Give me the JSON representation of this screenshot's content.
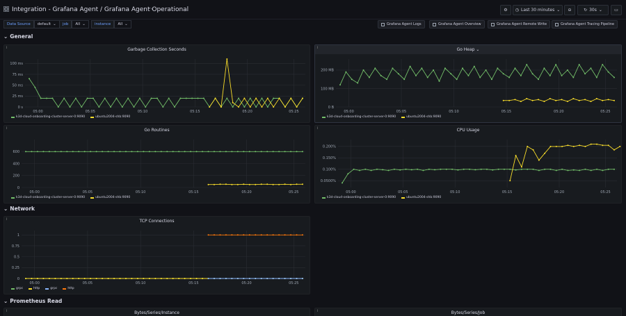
{
  "header": {
    "title_crumb": "Integration - Grafana Agent  / Grafana Agent Operational",
    "time_range": "Last 30 minutes",
    "refresh": "30s"
  },
  "variables": [
    {
      "label": "Data Source",
      "value": "default"
    },
    {
      "label": "job",
      "value": "All"
    },
    {
      "label": "instance",
      "value": "All"
    }
  ],
  "links": [
    "Grafana Agent Logs",
    "Grafana Agent Overview",
    "Grafana Agent Remote Write",
    "Grafana Agent Tracing Pipeline"
  ],
  "rows": {
    "general": "General",
    "network": "Network",
    "prometheus_read": "Prometheus Read"
  },
  "colors": {
    "green": "#73bf69",
    "yellow": "#fade2a",
    "blue": "#8ab8ff",
    "orange": "#ff780a"
  },
  "x_ticks": [
    "05:00",
    "05:05",
    "05:10",
    "05:15",
    "05:20",
    "05:25"
  ],
  "legend_default": [
    "k3d-cloud-onboarding-cluster-server-0:9090",
    "ubuntu2004-shb:9090"
  ],
  "legend_tcp": [
    "grpc",
    "http",
    "grpc",
    "http"
  ],
  "panels": {
    "gc": {
      "title": "Garbage Collection Seconds",
      "y_ticks": [
        "100 ms",
        "75 ms",
        "50 ms",
        "25 ms",
        "0 s"
      ]
    },
    "heap": {
      "title": "Go Heap",
      "y_ticks": [
        "200 MB",
        "100 MB",
        "0 B"
      ]
    },
    "routines": {
      "title": "Go Routines",
      "y_ticks": [
        "800",
        "600",
        "400",
        "200",
        "0"
      ]
    },
    "cpu": {
      "title": "CPU Usage",
      "y_ticks": [
        "0.200%",
        "0.150%",
        "0.100%",
        "0.0500%"
      ]
    },
    "tcp": {
      "title": "TCP Connections",
      "y_ticks": [
        "1",
        "0.75",
        "0.5",
        "0.25",
        "0"
      ]
    },
    "bytes_instance": {
      "title": "Bytes/Series/Instance"
    },
    "bytes_job": {
      "title": "Bytes/Series/Job"
    }
  },
  "chart_data": [
    {
      "type": "line",
      "title": "Garbage Collection Seconds",
      "ylim": [
        0,
        110
      ],
      "unit": "ms",
      "series": [
        {
          "name": "k3d-cloud-onboarding-cluster-server-0:9090",
          "values": [
            65,
            45,
            20,
            20,
            20,
            0,
            20,
            0,
            20,
            0,
            20,
            20,
            0,
            20,
            0,
            20,
            0,
            20,
            0,
            20,
            0,
            20,
            20,
            0,
            20,
            0,
            20,
            20,
            20,
            20,
            20,
            0,
            20,
            0,
            20,
            0,
            20,
            0,
            20,
            0,
            20,
            0,
            20,
            20,
            0,
            20,
            0,
            20
          ]
        },
        {
          "name": "ubuntu2004-shb:9090",
          "values": [
            null,
            null,
            null,
            null,
            null,
            null,
            null,
            null,
            null,
            null,
            null,
            null,
            null,
            null,
            null,
            null,
            null,
            null,
            null,
            null,
            null,
            null,
            null,
            null,
            null,
            null,
            null,
            null,
            null,
            null,
            null,
            0,
            20,
            0,
            110,
            10,
            0,
            20,
            0,
            20,
            0,
            20,
            0,
            20,
            0,
            20,
            0,
            20
          ]
        }
      ]
    },
    {
      "type": "line",
      "title": "Go Heap",
      "ylim": [
        0,
        260
      ],
      "unit": "MB",
      "series": [
        {
          "name": "k3d-cloud-onboarding-cluster-server-0:9090",
          "values": [
            120,
            190,
            150,
            130,
            200,
            160,
            210,
            170,
            150,
            210,
            180,
            150,
            220,
            170,
            210,
            160,
            200,
            140,
            210,
            180,
            150,
            210,
            170,
            220,
            160,
            200,
            150,
            210,
            180,
            160,
            210,
            170,
            230,
            180,
            150,
            210,
            170,
            230,
            170,
            200,
            160,
            230,
            180,
            210,
            160,
            230,
            190,
            160
          ]
        },
        {
          "name": "ubuntu2004-shb:9090",
          "values": [
            null,
            null,
            null,
            null,
            null,
            null,
            null,
            null,
            null,
            null,
            null,
            null,
            null,
            null,
            null,
            null,
            null,
            null,
            null,
            null,
            null,
            null,
            null,
            null,
            null,
            null,
            null,
            null,
            35,
            35,
            40,
            30,
            45,
            35,
            40,
            30,
            45,
            35,
            40,
            30,
            45,
            35,
            40,
            30,
            45,
            35,
            40,
            35
          ]
        }
      ]
    },
    {
      "type": "line",
      "title": "Go Routines",
      "ylim": [
        0,
        800
      ],
      "series": [
        {
          "name": "k3d-cloud-onboarding-cluster-server-0:9090",
          "values": [
            600,
            600,
            600,
            600,
            600,
            600,
            600,
            600,
            600,
            600,
            600,
            600,
            600,
            600,
            600,
            600,
            600,
            600,
            600,
            600,
            600,
            600,
            600,
            600,
            600,
            600,
            600,
            600,
            600,
            600,
            600,
            600,
            600,
            600,
            600,
            600,
            600,
            600,
            600,
            600,
            600,
            600,
            600,
            600,
            600,
            600,
            600,
            600
          ]
        },
        {
          "name": "ubuntu2004-shb:9090",
          "values": [
            null,
            null,
            null,
            null,
            null,
            null,
            null,
            null,
            null,
            null,
            null,
            null,
            null,
            null,
            null,
            null,
            null,
            null,
            null,
            null,
            null,
            null,
            null,
            null,
            null,
            null,
            null,
            null,
            null,
            null,
            null,
            50,
            50,
            55,
            55,
            50,
            50,
            55,
            50,
            50,
            55,
            55,
            50,
            50,
            55,
            50,
            55,
            55
          ]
        }
      ]
    },
    {
      "type": "line",
      "title": "CPU Usage",
      "ylim": [
        0.02,
        0.23
      ],
      "unit": "%",
      "series": [
        {
          "name": "k3d-cloud-onboarding-cluster-server-0:9090",
          "values": [
            0.04,
            0.08,
            0.1,
            0.095,
            0.1,
            0.095,
            0.1,
            0.098,
            0.095,
            0.1,
            0.097,
            0.1,
            0.098,
            0.1,
            0.095,
            0.1,
            0.098,
            0.1,
            0.1,
            0.1,
            0.097,
            0.1,
            0.1,
            0.098,
            0.1,
            0.1,
            0.097,
            0.1,
            0.1,
            0.1,
            0.097,
            0.1,
            0.1,
            0.1,
            0.095,
            0.1,
            0.1,
            0.095,
            0.1,
            0.095,
            0.097,
            0.095,
            0.1,
            0.095,
            0.1,
            0.095,
            0.1,
            0.1
          ]
        },
        {
          "name": "ubuntu2004-shb:9090",
          "values": [
            null,
            null,
            null,
            null,
            null,
            null,
            null,
            null,
            null,
            null,
            null,
            null,
            null,
            null,
            null,
            null,
            null,
            null,
            null,
            null,
            null,
            null,
            null,
            null,
            null,
            null,
            null,
            null,
            null,
            0.05,
            0.16,
            0.11,
            0.2,
            0.185,
            0.14,
            0.17,
            0.2,
            0.2,
            0.2,
            0.205,
            0.2,
            0.205,
            0.2,
            0.21,
            0.21,
            0.205,
            0.205,
            0.185,
            0.2
          ]
        }
      ]
    },
    {
      "type": "line",
      "title": "TCP Connections",
      "ylim": [
        0,
        1.1
      ],
      "series": [
        {
          "name": "grpc",
          "values": [
            0,
            0,
            0,
            0,
            0,
            0,
            0,
            0,
            0,
            0,
            0,
            0,
            0,
            0,
            0,
            0,
            0,
            0,
            0,
            0,
            0,
            0,
            0,
            0,
            0,
            0,
            0,
            0,
            0,
            0,
            0,
            0,
            0,
            0,
            0,
            0,
            0,
            0,
            0,
            0,
            0,
            0,
            0,
            0,
            0,
            0,
            0,
            0
          ]
        },
        {
          "name": "http",
          "values": [
            0,
            0,
            0,
            0,
            0,
            0,
            0,
            0,
            0,
            0,
            0,
            0,
            0,
            0,
            0,
            0,
            0,
            0,
            0,
            0,
            0,
            0,
            0,
            0,
            0,
            0,
            0,
            0,
            0,
            0,
            0,
            0,
            0,
            0,
            0,
            0,
            0,
            0,
            0,
            0,
            0,
            0,
            0,
            0,
            0,
            0,
            0,
            0
          ]
        },
        {
          "name": "grpc",
          "values": [
            null,
            null,
            null,
            null,
            null,
            null,
            null,
            null,
            null,
            null,
            null,
            null,
            null,
            null,
            null,
            null,
            null,
            null,
            null,
            null,
            null,
            null,
            null,
            null,
            null,
            null,
            null,
            null,
            null,
            null,
            null,
            0,
            0,
            0,
            0,
            0,
            0,
            0,
            0,
            0,
            0,
            0,
            0,
            0,
            0,
            0,
            0,
            0
          ]
        },
        {
          "name": "http",
          "values": [
            null,
            null,
            null,
            null,
            null,
            null,
            null,
            null,
            null,
            null,
            null,
            null,
            null,
            null,
            null,
            null,
            null,
            null,
            null,
            null,
            null,
            null,
            null,
            null,
            null,
            null,
            null,
            null,
            null,
            null,
            null,
            1,
            1,
            1,
            1,
            1,
            1,
            1,
            1,
            1,
            1,
            1,
            1,
            1,
            1,
            1,
            1,
            1
          ]
        }
      ]
    }
  ]
}
